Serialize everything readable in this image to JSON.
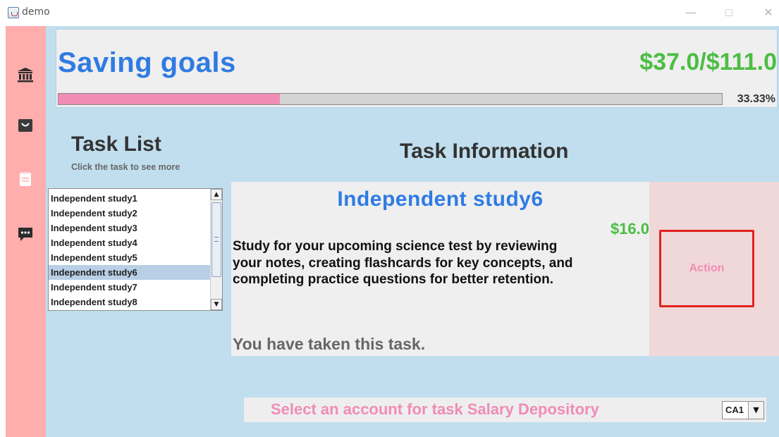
{
  "window": {
    "title": "demo",
    "minimize_glyph": "—",
    "close_glyph": "✕"
  },
  "sidebar": {
    "items": [
      {
        "icon": "bank-icon"
      },
      {
        "icon": "shopping-bag-icon"
      },
      {
        "icon": "clipboard-icon"
      },
      {
        "icon": "chat-bubble-icon"
      }
    ],
    "color": "#ffadad"
  },
  "savings": {
    "title": "Saving goals",
    "amount_text": "$37.0/$111.0",
    "progress_percent_text": "33.33%",
    "progress_fraction": 0.3333
  },
  "task_list": {
    "heading": "Task List",
    "hint": "Click the task to see more",
    "items": [
      "Independent study1",
      "Independent study2",
      "Independent study3",
      "Independent study4",
      "Independent study5",
      "Independent study6",
      "Independent study7",
      "Independent study8"
    ],
    "selected": "Independent study6"
  },
  "task_info": {
    "heading": "Task Information",
    "name": "Independent study6",
    "reward": "$16.0",
    "description": "Study for your upcoming science test by reviewing your notes, creating flashcards for key concepts, and completing practice questions for better retention.",
    "status": "You have taken this task.",
    "action_label": "Action"
  },
  "account": {
    "label": "Select an account for task Salary Depository",
    "selected": "CA1"
  },
  "colors": {
    "main_bg": "#c0deee",
    "title_blue": "#2f7be3",
    "amount_green": "#4cbd43",
    "accent_pink": "#f08cb6",
    "action_border": "#e3211f"
  }
}
